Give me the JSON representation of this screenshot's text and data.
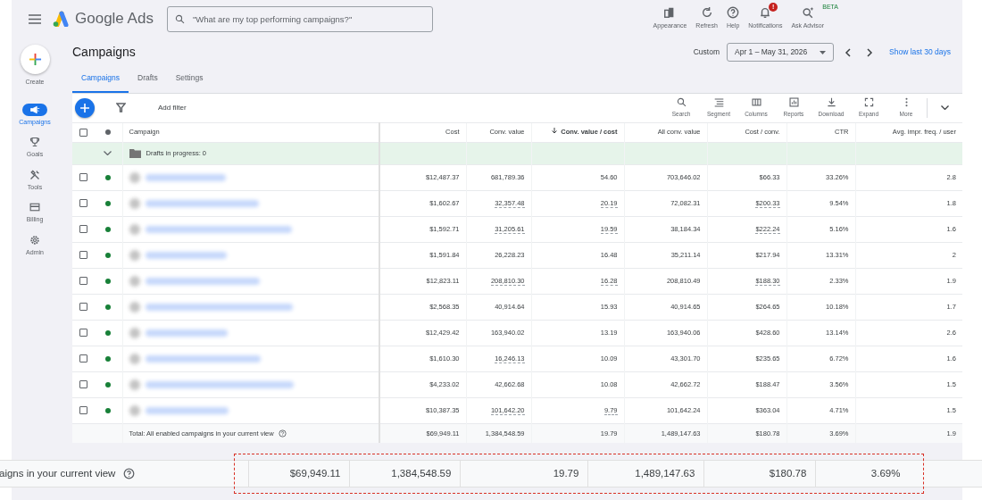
{
  "header": {
    "product": "Google Ads",
    "search": {
      "placeholder": "\"What are my top performing campaigns?\""
    },
    "actions": [
      {
        "kind": "appearance",
        "label": "Appearance"
      },
      {
        "kind": "refresh",
        "label": "Refresh"
      },
      {
        "kind": "help",
        "label": "Help"
      },
      {
        "kind": "notifications",
        "label": "Notifications",
        "badge": "!"
      },
      {
        "kind": "advisor",
        "label": "Ask Advisor",
        "tag": "BETA"
      }
    ]
  },
  "sidebar": {
    "create": "Create",
    "items": [
      {
        "kind": "campaigns",
        "label": "Campaigns",
        "selected": true
      },
      {
        "kind": "goals",
        "label": "Goals",
        "selected": false
      },
      {
        "kind": "tools",
        "label": "Tools",
        "selected": false
      },
      {
        "kind": "billing",
        "label": "Billing",
        "selected": false
      },
      {
        "kind": "admin",
        "label": "Admin",
        "selected": false
      }
    ]
  },
  "page": {
    "title": "Campaigns",
    "range_label": "Custom",
    "date_range": "Apr 1 – May 31, 2026",
    "show_last": "Show last 30 days"
  },
  "tabs": [
    {
      "label": "Campaigns",
      "selected": true
    },
    {
      "label": "Drafts",
      "selected": false
    },
    {
      "label": "Settings",
      "selected": false
    }
  ],
  "toolbar": {
    "add_filter": "Add filter",
    "tools": [
      {
        "kind": "search",
        "label": "Search"
      },
      {
        "kind": "segment",
        "label": "Segment"
      },
      {
        "kind": "columns",
        "label": "Columns"
      },
      {
        "kind": "reports",
        "label": "Reports"
      },
      {
        "kind": "download",
        "label": "Download"
      },
      {
        "kind": "expand",
        "label": "Expand"
      },
      {
        "kind": "more",
        "label": "More"
      }
    ]
  },
  "table": {
    "all_checked": false,
    "campaign_header": "Campaign",
    "columns": [
      {
        "label": "Cost",
        "sorted": false
      },
      {
        "label": "Conv. value",
        "sorted": false
      },
      {
        "label": "Conv. value / cost",
        "sorted": true
      },
      {
        "label": "All conv. value",
        "sorted": false
      },
      {
        "label": "Cost / conv.",
        "sorted": false
      },
      {
        "label": "CTR",
        "sorted": false
      },
      {
        "label": "Avg. impr. freq. / user",
        "sorted": false
      }
    ],
    "drafts_row": {
      "label": "Drafts in progress: 0",
      "expanded": false
    },
    "rows": [
      {
        "checked": false,
        "color": "#188038",
        "cells": [
          "$12,487.37",
          "681,789.36",
          "54.60",
          "703,646.02",
          "$66.33",
          "33.26%",
          "2.8"
        ],
        "dotted": [
          false,
          false,
          false,
          false,
          false,
          false,
          false
        ]
      },
      {
        "checked": false,
        "color": "#188038",
        "cells": [
          "$1,602.67",
          "32,357.48",
          "20.19",
          "72,082.31",
          "$200.33",
          "9.54%",
          "1.8"
        ],
        "dotted": [
          false,
          true,
          true,
          false,
          true,
          false,
          false
        ]
      },
      {
        "checked": false,
        "color": "#188038",
        "cells": [
          "$1,592.71",
          "31,205.61",
          "19.59",
          "38,184.34",
          "$222.24",
          "5.16%",
          "1.6"
        ],
        "dotted": [
          false,
          true,
          true,
          false,
          true,
          false,
          false
        ]
      },
      {
        "checked": false,
        "color": "#188038",
        "cells": [
          "$1,591.84",
          "26,228.23",
          "16.48",
          "35,211.14",
          "$217.94",
          "13.31%",
          "2"
        ],
        "dotted": [
          false,
          false,
          false,
          false,
          false,
          false,
          false
        ]
      },
      {
        "checked": false,
        "color": "#188038",
        "cells": [
          "$12,823.11",
          "208,810.30",
          "16.28",
          "208,810.49",
          "$188.30",
          "2.33%",
          "1.9"
        ],
        "dotted": [
          false,
          true,
          true,
          false,
          true,
          false,
          false
        ]
      },
      {
        "checked": false,
        "color": "#188038",
        "cells": [
          "$2,568.35",
          "40,914.64",
          "15.93",
          "40,914.65",
          "$264.65",
          "10.18%",
          "1.7"
        ],
        "dotted": [
          false,
          false,
          false,
          false,
          false,
          false,
          false
        ]
      },
      {
        "checked": false,
        "color": "#188038",
        "cells": [
          "$12,429.42",
          "163,940.02",
          "13.19",
          "163,940.06",
          "$428.60",
          "13.14%",
          "2.6"
        ],
        "dotted": [
          false,
          false,
          false,
          false,
          false,
          false,
          false
        ]
      },
      {
        "checked": false,
        "color": "#188038",
        "cells": [
          "$1,610.30",
          "16,246.13",
          "10.09",
          "43,301.70",
          "$235.65",
          "6.72%",
          "1.6"
        ],
        "dotted": [
          false,
          true,
          false,
          false,
          false,
          false,
          false
        ]
      },
      {
        "checked": false,
        "color": "#188038",
        "cells": [
          "$4,233.02",
          "42,662.68",
          "10.08",
          "42,662.72",
          "$188.47",
          "3.56%",
          "1.5"
        ],
        "dotted": [
          false,
          false,
          false,
          false,
          false,
          false,
          false
        ]
      },
      {
        "checked": false,
        "color": "#188038",
        "cells": [
          "$10,387.35",
          "101,642.20",
          "9.79",
          "101,642.24",
          "$363.04",
          "4.71%",
          "1.5"
        ],
        "dotted": [
          false,
          true,
          true,
          false,
          false,
          false,
          false
        ]
      }
    ],
    "total": {
      "label": "Total: All enabled campaigns in your current view",
      "cells": [
        "$69,949.11",
        "1,384,548.59",
        "19.79",
        "1,489,147.63",
        "$180.78",
        "3.69%",
        "1.9"
      ]
    }
  },
  "callout": {
    "label": "aigns in your current view",
    "cells": [
      "$69,949.11",
      "1,384,548.59",
      "19.79",
      "1,489,147.63",
      "$180.78",
      "3.69%"
    ]
  }
}
